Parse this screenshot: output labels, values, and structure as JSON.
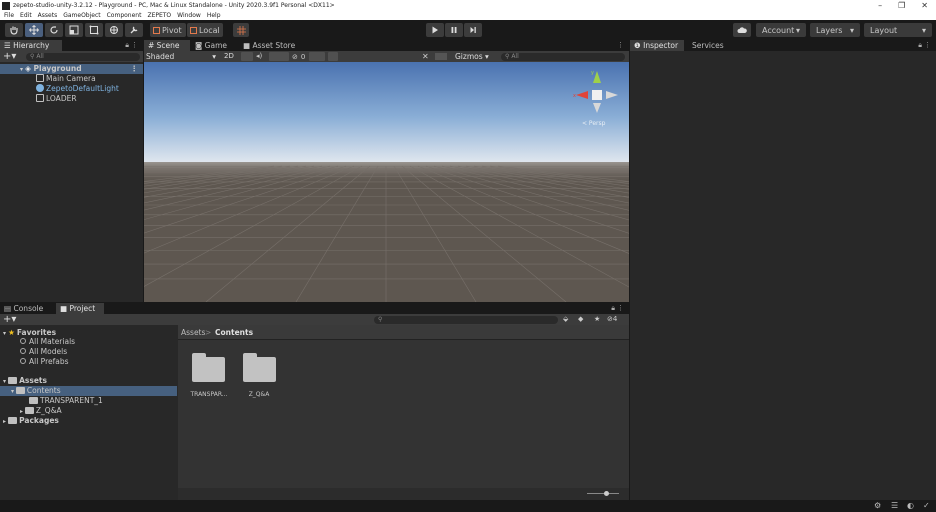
{
  "window": {
    "title": "zepeto-studio-unity-3.2.12 - Playground - PC, Mac & Linux Standalone - Unity 2020.3.9f1 Personal <DX11>",
    "controls": [
      "–",
      "❐",
      "✕"
    ]
  },
  "menu": [
    "File",
    "Edit",
    "Assets",
    "GameObject",
    "Component",
    "ZEPETO",
    "Window",
    "Help"
  ],
  "toolbar": {
    "pivot": "Pivot",
    "local": "Local",
    "account": "Account",
    "layers": "Layers",
    "layout": "Layout"
  },
  "hierarchy": {
    "tab": "Hierarchy",
    "search_placeholder": "All",
    "scene": "Playground",
    "items": [
      "Main Camera",
      "ZepetoDefaultLight",
      "LOADER"
    ]
  },
  "scene_view": {
    "tabs": [
      "Scene",
      "Game",
      "Asset Store"
    ],
    "shading": "Shaded",
    "mode": "2D",
    "fx_count": "0",
    "gizmos": "Gizmos",
    "search_placeholder": "All",
    "persp_label": "< Persp",
    "colors": {
      "sky_top": "#4a72b0",
      "horizon": "#dfe6ee",
      "ground": "#5e5750"
    }
  },
  "inspector": {
    "tabs": [
      "Inspector",
      "Services"
    ]
  },
  "project": {
    "tabs": [
      "Console",
      "Project"
    ],
    "hidden_count": "4",
    "favorites": {
      "label": "Favorites",
      "items": [
        "All Materials",
        "All Models",
        "All Prefabs"
      ]
    },
    "assets": {
      "label": "Assets",
      "children": [
        "Contents"
      ],
      "grandchildren": [
        "TRANSPARENT_1",
        "Z_Q&A"
      ]
    },
    "packages": "Packages",
    "breadcrumb": [
      "Assets",
      "Contents"
    ],
    "folders": [
      "TRANSPAR...",
      "Z_Q&A"
    ]
  }
}
